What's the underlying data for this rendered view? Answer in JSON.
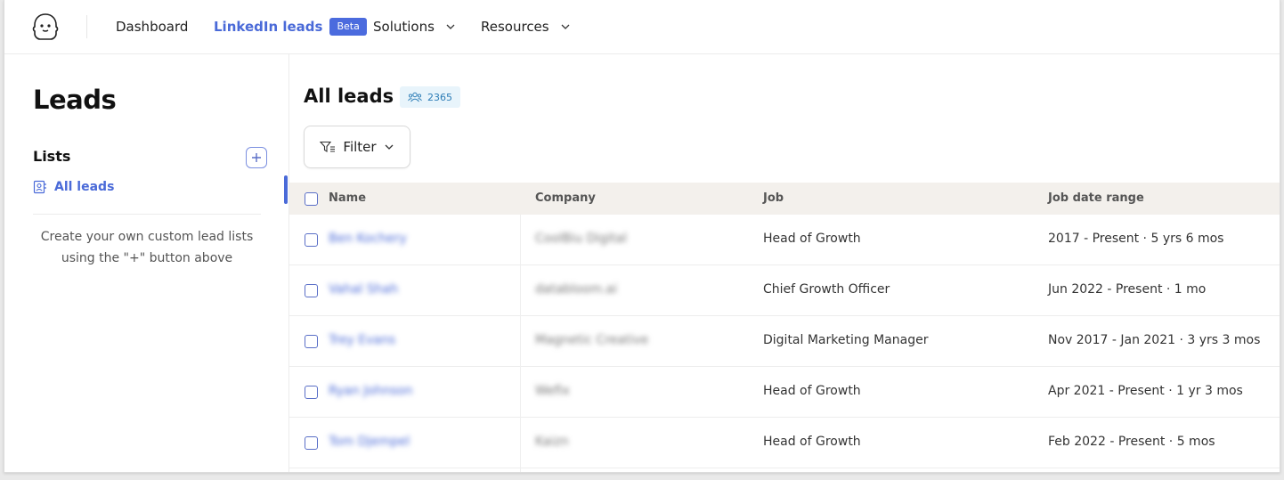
{
  "nav": {
    "items": [
      {
        "label": "Dashboard"
      },
      {
        "label": "LinkedIn leads",
        "badge": "Beta"
      },
      {
        "label": "Solutions"
      },
      {
        "label": "Resources"
      }
    ]
  },
  "sidebar": {
    "title": "Leads",
    "lists_label": "Lists",
    "all_leads_label": "All leads",
    "hint": "Create your own custom lead lists using the \"+\" button above"
  },
  "main": {
    "title": "All leads",
    "count": "2365",
    "filter_label": "Filter",
    "columns": [
      "Name",
      "Company",
      "Job",
      "Job date range"
    ],
    "rows": [
      {
        "name": "Ben Kochery",
        "company": "CoolBiu Digital",
        "job": "Head of Growth",
        "date_range": "2017 - Present · 5 yrs 6 mos"
      },
      {
        "name": "Vahal Shah",
        "company": "databloom.ai",
        "job": "Chief Growth Officer",
        "date_range": "Jun 2022 - Present · 1 mo"
      },
      {
        "name": "Trey Evans",
        "company": "Magnetic Creative",
        "job": "Digital Marketing Manager",
        "date_range": "Nov 2017 - Jan 2021 · 3 yrs 3 mos"
      },
      {
        "name": "Ryan Johnson",
        "company": "Wefix",
        "job": "Head of Growth",
        "date_range": "Apr 2021 - Present · 1 yr 3 mos"
      },
      {
        "name": "Tom Djempel",
        "company": "Kaizn",
        "job": "Head of Growth",
        "date_range": "Feb 2022 - Present · 5 mos"
      }
    ]
  },
  "colors": {
    "accent": "#4a6ad8",
    "badge_bg": "#e8f4fb",
    "header_bg": "#f3f0ec"
  }
}
